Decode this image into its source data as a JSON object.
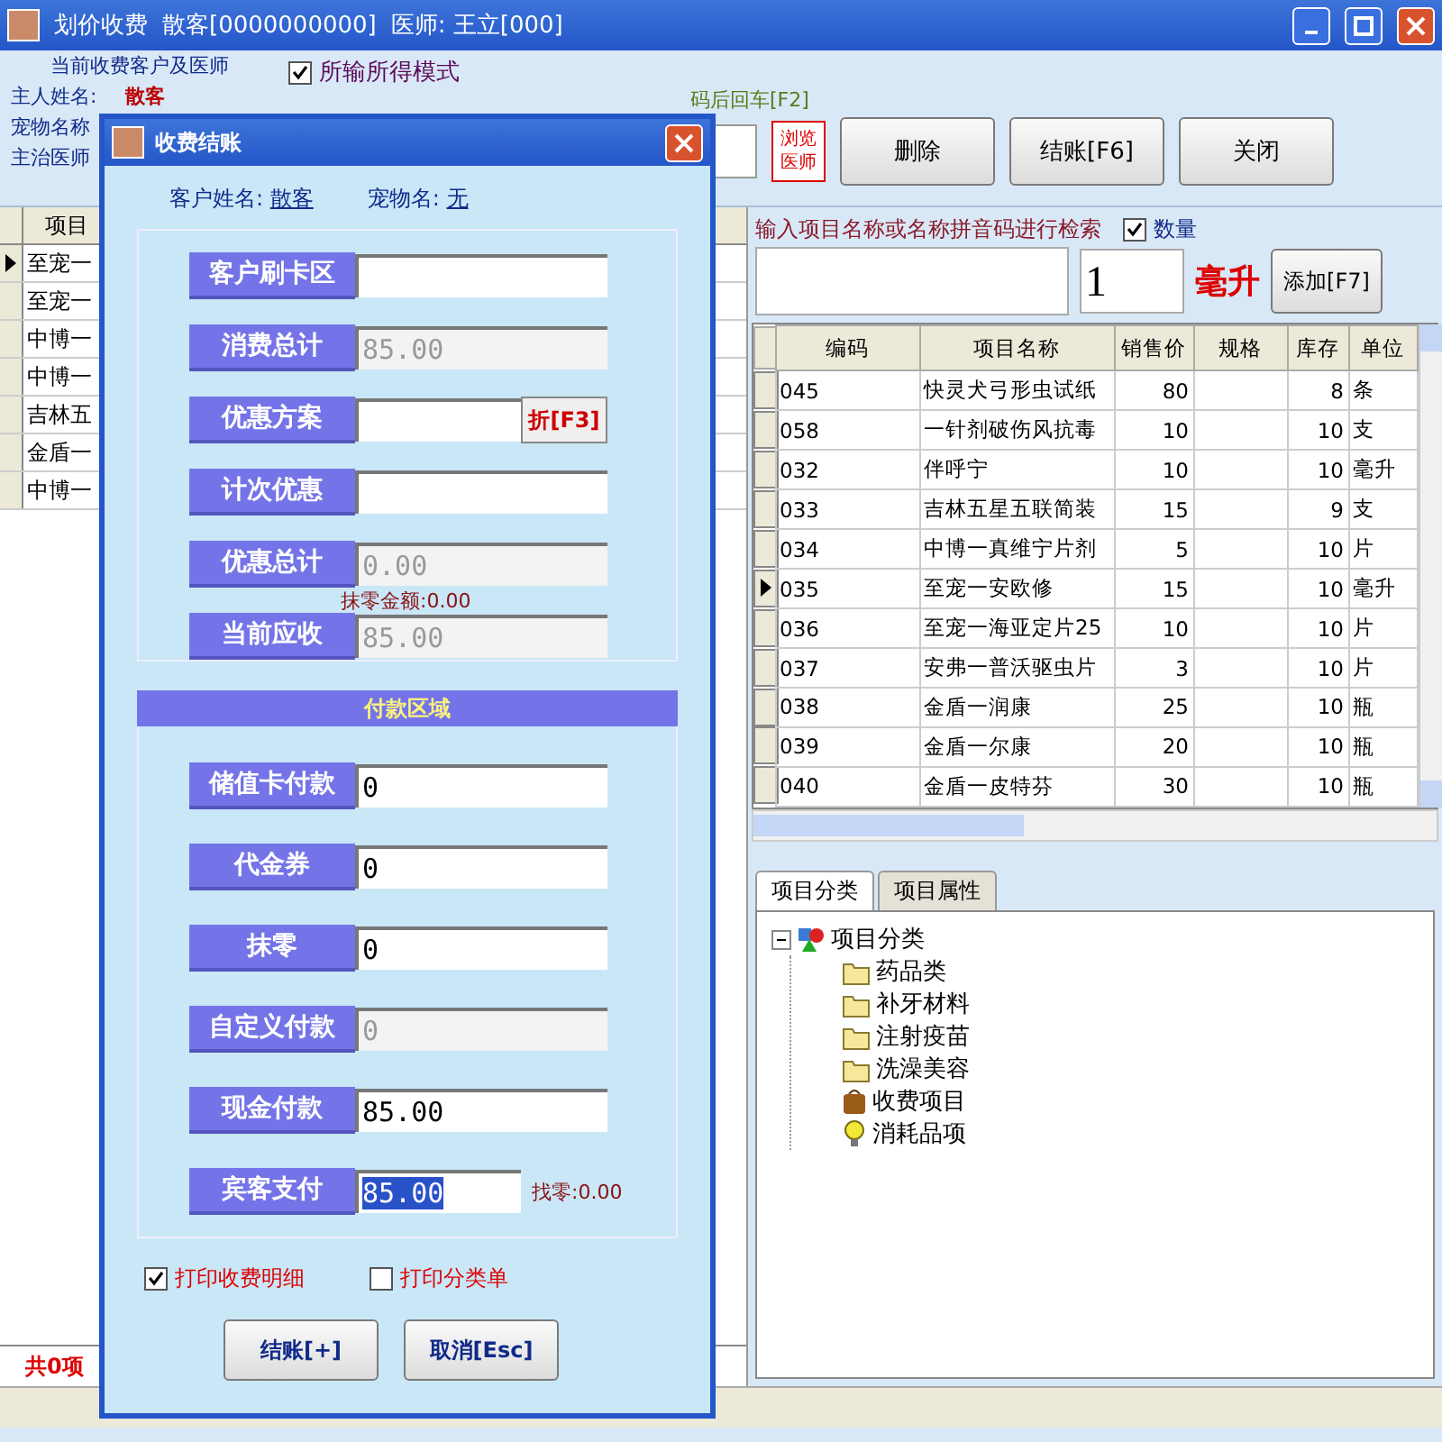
{
  "window": {
    "title": "划价收费",
    "customer": "散客[0000000000]",
    "doctor": "医师: 王立[000]"
  },
  "client_panel": {
    "heading": "当前收费客户及医师",
    "owner_label": "主人姓名:",
    "owner": "散客",
    "pet_label": "宠物名称",
    "doctor_label": "主治医师"
  },
  "mode_checkbox": {
    "label": "所输所得模式",
    "checked": true
  },
  "hint": "码后回车[F2]",
  "browse_doctor_button": "浏览医师",
  "toolbar_buttons": [
    "删除",
    "结账[F6]",
    "关闭"
  ],
  "left_list": {
    "column": "项目",
    "rows": [
      {
        "name": "至宠一",
        "selected": true
      },
      {
        "name": "至宠一",
        "selected": false
      },
      {
        "name": "中博一",
        "selected": false
      },
      {
        "name": "中博一",
        "selected": false
      },
      {
        "name": "吉林五",
        "selected": false
      },
      {
        "name": "金盾一",
        "selected": false
      },
      {
        "name": "中博一",
        "selected": false
      }
    ],
    "footer": "共0项"
  },
  "search": {
    "label": "输入项目名称或名称拼音码进行检索",
    "quantity_checkbox": {
      "label": "数量",
      "checked": true
    },
    "quantity": "1",
    "unit": "毫升",
    "add_button": "添加[F7]"
  },
  "table": {
    "columns": [
      "编码",
      "项目名称",
      "销售价",
      "规格",
      "库存",
      "单位"
    ],
    "rows": [
      {
        "code": "045",
        "name": "快灵犬弓形虫试纸",
        "price": "80",
        "stock": "8",
        "unit": "条",
        "selected": false
      },
      {
        "code": "058",
        "name": "一针剂破伤风抗毒",
        "price": "10",
        "stock": "10",
        "unit": "支",
        "selected": false
      },
      {
        "code": "032",
        "name": "伴呼宁",
        "price": "10",
        "stock": "10",
        "unit": "毫升",
        "selected": false
      },
      {
        "code": "033",
        "name": "吉林五星五联简装",
        "price": "15",
        "stock": "9",
        "unit": "支",
        "selected": false
      },
      {
        "code": "034",
        "name": "中博一真维宁片剂",
        "price": "5",
        "stock": "10",
        "unit": "片",
        "selected": false
      },
      {
        "code": "035",
        "name": "至宠一安欧修",
        "price": "15",
        "stock": "10",
        "unit": "毫升",
        "selected": true
      },
      {
        "code": "036",
        "name": "至宠一海亚定片25",
        "price": "10",
        "stock": "10",
        "unit": "片",
        "selected": false
      },
      {
        "code": "037",
        "name": "安弗一普沃驱虫片",
        "price": "3",
        "stock": "10",
        "unit": "片",
        "selected": false
      },
      {
        "code": "038",
        "name": "金盾一润康",
        "price": "25",
        "stock": "10",
        "unit": "瓶",
        "selected": false
      },
      {
        "code": "039",
        "name": "金盾一尔康",
        "price": "20",
        "stock": "10",
        "unit": "瓶",
        "selected": false
      },
      {
        "code": "040",
        "name": "金盾一皮特芬",
        "price": "30",
        "stock": "10",
        "unit": "瓶",
        "selected": false
      }
    ]
  },
  "tabs": [
    {
      "label": "项目分类",
      "selected": true
    },
    {
      "label": "项目属性",
      "selected": false
    }
  ],
  "tree": {
    "label": "项目分类",
    "kind": "category",
    "expanded": true,
    "children": [
      {
        "label": "药品类",
        "kind": "folder"
      },
      {
        "label": "补牙材料",
        "kind": "folder"
      },
      {
        "label": "注射疫苗",
        "kind": "folder"
      },
      {
        "label": "洗澡美容",
        "kind": "folder"
      },
      {
        "label": "收费项目",
        "kind": "bag"
      },
      {
        "label": "消耗品项",
        "kind": "bulb"
      }
    ]
  },
  "dialog": {
    "title": "收费结账",
    "customer_label": "客户姓名:",
    "customer": "散客",
    "pet_label": "宠物名:",
    "pet": "无",
    "fields": [
      {
        "label": "客户刷卡区",
        "disabled": false
      },
      {
        "label": "消费总计",
        "value": "85.00",
        "disabled": true
      },
      {
        "label": "优惠方案",
        "disabled": false,
        "button": "折[F3]"
      },
      {
        "label": "计次优惠",
        "disabled": false
      },
      {
        "label": "优惠总计",
        "value": "0.00",
        "disabled": true,
        "note": "抹零金额:0.00"
      },
      {
        "label": "当前应收",
        "value": "85.00",
        "disabled": true
      }
    ],
    "payment_heading": "付款区域",
    "payments": [
      {
        "label": "储值卡付款",
        "value": "0",
        "disabled": false,
        "highlighted": false
      },
      {
        "label": "代金券",
        "value": "0",
        "disabled": false,
        "highlighted": false
      },
      {
        "label": "抹零",
        "value": "0",
        "disabled": false,
        "highlighted": false
      },
      {
        "label": "自定义付款",
        "value": "0",
        "disabled": true,
        "highlighted": false
      },
      {
        "label": "现金付款",
        "value": "85.00",
        "disabled": false,
        "highlighted": false
      },
      {
        "label": "宾客支付",
        "value": "85.00",
        "disabled": false,
        "highlighted": true,
        "note": "找零:0.00"
      }
    ],
    "options": [
      {
        "label": "打印收费明细",
        "checked": true
      },
      {
        "label": "打印分类单",
        "checked": false
      }
    ],
    "buttons": [
      "结账[+]",
      "取消[Esc]"
    ]
  }
}
